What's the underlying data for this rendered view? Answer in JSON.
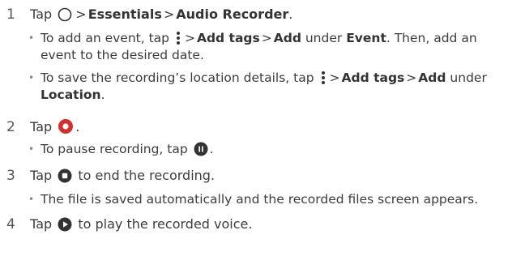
{
  "steps": [
    {
      "num": "1",
      "tap": "Tap",
      "sep": ">",
      "path1": "Essentials",
      "path2": "Audio Recorder",
      "end": "."
    },
    {
      "num": "2",
      "tap": "Tap",
      "end": "."
    },
    {
      "num": "3",
      "tap": "Tap",
      "rest": "to end the recording."
    },
    {
      "num": "4",
      "tap": "Tap",
      "rest": "to play the recorded voice."
    }
  ],
  "sub": {
    "event": {
      "a": "To add an event, tap",
      "gt": ">",
      "b1": "Add tags",
      "b2": "Add",
      "c": "under",
      "b3": "Event",
      "d": ". Then, add an event to the desired date."
    },
    "location": {
      "a": "To save the recording’s location details, tap",
      "gt": ">",
      "b1": "Add tags",
      "b2": "Add",
      "c": "under",
      "b3": "Location",
      "d": "."
    },
    "pause": {
      "a": "To pause recording, tap",
      "d": "."
    },
    "saved": {
      "a": "The file is saved automatically and the recorded files screen appears."
    }
  },
  "bullet": "•",
  "colors": {
    "record": "#d32f2f",
    "icon_dark": "#333333"
  },
  "icons": [
    "home-circle-icon",
    "more-vertical-icon",
    "record-icon",
    "pause-icon",
    "stop-icon",
    "play-icon"
  ]
}
